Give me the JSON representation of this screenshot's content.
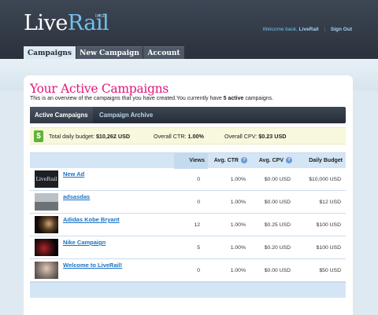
{
  "header": {
    "logo": {
      "part1": "Live",
      "part2": "Rail"
    },
    "beta_label": "beta",
    "welcome_text": "Welcome back,",
    "username": "LiveRail",
    "signout_label": "Sign Out"
  },
  "nav": {
    "tabs": [
      {
        "label": "Campaigns",
        "active": true
      },
      {
        "label": "New Campaign",
        "active": false
      },
      {
        "label": "Account",
        "active": false
      }
    ]
  },
  "page": {
    "title": "Your Active Campaigns",
    "intro_before": "This is an overview of the campaigns that you have created.You currently have",
    "intro_count": "5 active",
    "intro_after": "campaigns."
  },
  "subtabs": [
    {
      "label": "Active Campaigns",
      "active": true
    },
    {
      "label": "Campaign Archive",
      "active": false
    }
  ],
  "summary": {
    "dollar_icon": "$",
    "budget_label": "Total daily budget:",
    "budget_value": "$10,262 USD",
    "ctr_label": "Overall CTR:",
    "ctr_value": "1.00%",
    "cpv_label": "Overall CPV:",
    "cpv_value": "$0.23 USD"
  },
  "table": {
    "columns": {
      "views": "Views",
      "ctr": "Avg. CTR",
      "cpv": "Avg. CPV",
      "budget": "Daily Budget"
    },
    "info_icon": "?",
    "rows": [
      {
        "name": "New Ad",
        "views": "0",
        "ctr": "1.00%",
        "cpv": "$0.00 USD",
        "budget": "$10,000 USD",
        "thumb_text": "LiveRail"
      },
      {
        "name": "adsasdas",
        "views": "0",
        "ctr": "1.00%",
        "cpv": "$0.00 USD",
        "budget": "$12 USD",
        "thumb_text": ""
      },
      {
        "name": "Adidas Kobe Bryant",
        "views": "12",
        "ctr": "1.00%",
        "cpv": "$0.25 USD",
        "budget": "$100 USD",
        "thumb_text": ""
      },
      {
        "name": "Nike Campaign",
        "views": "5",
        "ctr": "1.00%",
        "cpv": "$0.20 USD",
        "budget": "$100 USD",
        "thumb_text": ""
      },
      {
        "name": "Welcome to LiveRail!",
        "views": "0",
        "ctr": "1.00%",
        "cpv": "$0.00 USD",
        "budget": "$50 USD",
        "thumb_text": ""
      }
    ]
  },
  "colors": {
    "accent_pink": "#e0177b",
    "link_blue": "#1a72c4",
    "header_dark": "#2b323d",
    "table_header": "#d4e5f5"
  }
}
